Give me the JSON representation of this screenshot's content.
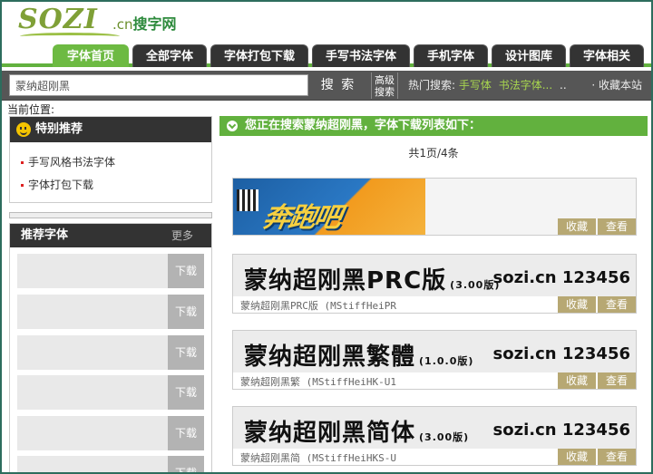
{
  "logo": {
    "main": "SOZI",
    "domain": ".cn",
    "cn": "搜字网"
  },
  "nav": {
    "tabs": [
      {
        "label": "字体首页",
        "active": true
      },
      {
        "label": "全部字体",
        "active": false
      },
      {
        "label": "字体打包下载",
        "active": false
      },
      {
        "label": "手写书法字体",
        "active": false
      },
      {
        "label": "手机字体",
        "active": false
      },
      {
        "label": "设计图库",
        "active": false
      },
      {
        "label": "字体相关",
        "active": false
      }
    ]
  },
  "search": {
    "value": "蒙纳超刚黑",
    "button": "搜 索",
    "advanced_line1": "高级",
    "advanced_line2": "搜索",
    "hot_label": "热门搜索:",
    "hot_items": [
      "手写体",
      "书法字体..."
    ],
    "hot_more": "..",
    "fav_site": "· 收藏本站"
  },
  "breadcrumb": {
    "label": "当前位置:"
  },
  "sidebar": {
    "recommend_title": "特别推荐",
    "recommend_items": [
      "手写风格书法字体",
      "字体打包下载"
    ],
    "fonts_title": "推荐字体",
    "fonts_more": "更多",
    "download_label": "下载"
  },
  "results": {
    "header": "您正在搜索蒙纳超刚黑，字体下载列表如下：",
    "page_info": "共1页/4条",
    "ad_text": "奔跑吧",
    "fav_label": "收藏",
    "view_label": "查看",
    "cards": [
      {
        "preview_name": "蒙纳超刚黑PRC版",
        "version": "(3.00版)",
        "brand": "sozi.cn 123456",
        "caption": "蒙纳超刚黑PRC版 (MStiffHeiPR"
      },
      {
        "preview_name": "蒙纳超刚黑繁體",
        "version": "(1.0.0版)",
        "brand": "sozi.cn 123456",
        "caption": "蒙纳超刚黑繁 (MStiffHeiHK-U1"
      },
      {
        "preview_name": "蒙纳超刚黑简体",
        "version": "(3.00版)",
        "brand": "sozi.cn 123456",
        "caption": "蒙纳超刚黑简 (MStiffHeiHKS-U"
      }
    ]
  },
  "colors": {
    "brand_green": "#62b13e",
    "nav_dark": "#333333",
    "button_tan": "#b7a873"
  }
}
